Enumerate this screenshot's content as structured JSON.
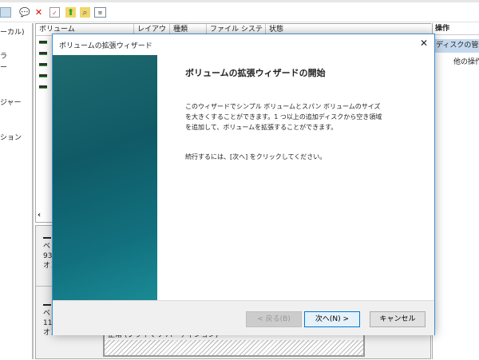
{
  "toolbar": {
    "icons": [
      "console-icon",
      "help-icon",
      "delete-icon",
      "properties-icon",
      "import-icon",
      "search-icon",
      "list-view-icon"
    ]
  },
  "tree": {
    "items": [
      "ーカル)",
      "ラ",
      "ー",
      "ジャー",
      "ション"
    ]
  },
  "list": {
    "columns": [
      "ボリューム",
      "レイアウト",
      "種類",
      "ファイル システム",
      "状態"
    ]
  },
  "lower": {
    "disk0": [
      "ベ",
      "93",
      "オン"
    ],
    "disk1": [
      "ベ",
      "11",
      "オン"
    ],
    "partition_status": "正常 (プライマリ パーティション)"
  },
  "actions": {
    "header": "操作",
    "selected": "ディスクの管理",
    "more": "他の操作"
  },
  "dialog": {
    "title": "ボリュームの拡張ウィザード",
    "heading": "ボリュームの拡張ウィザードの開始",
    "description": "このウィザードでシンプル ボリュームとスパン ボリュームのサイズを大きくすることができます。1 つ以上の追加ディスクから空き領域を追加して、ボリュームを拡張することができます。",
    "instruction": "続行するには、[次へ] をクリックしてください。",
    "back_label": "< 戻る(B)",
    "next_label": "次へ(N) >",
    "cancel_label": "キャンセル",
    "close": "✕"
  }
}
